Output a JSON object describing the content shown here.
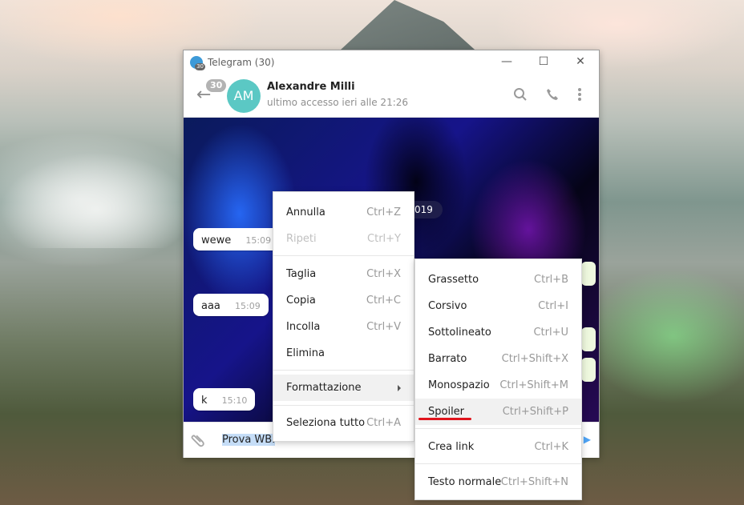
{
  "window": {
    "title": "Telegram (30)",
    "app_icon_badge": "30",
    "controls": {
      "minimize": "—",
      "maximize": "☐",
      "close": "✕"
    }
  },
  "chat_header": {
    "unread_count": "30",
    "avatar_initials": "AM",
    "contact_name": "Alexandre Milli",
    "status": "ultimo accesso ieri alle 21:26"
  },
  "chat": {
    "date_pill": "019",
    "messages": [
      {
        "text": "wewe",
        "time": "15:09"
      },
      {
        "text": "aaa",
        "time": "15:09"
      },
      {
        "text": "k",
        "time": "15:10"
      }
    ]
  },
  "composer": {
    "text": "Prova WBI"
  },
  "context_menu": {
    "items": [
      {
        "label": "Annulla",
        "shortcut": "Ctrl+Z"
      },
      {
        "label": "Ripeti",
        "shortcut": "Ctrl+Y"
      },
      {
        "label": "Taglia",
        "shortcut": "Ctrl+X"
      },
      {
        "label": "Copia",
        "shortcut": "Ctrl+C"
      },
      {
        "label": "Incolla",
        "shortcut": "Ctrl+V"
      },
      {
        "label": "Elimina",
        "shortcut": ""
      },
      {
        "label": "Formattazione",
        "shortcut": ""
      },
      {
        "label": "Seleziona tutto",
        "shortcut": "Ctrl+A"
      }
    ]
  },
  "format_submenu": {
    "items": [
      {
        "label": "Grassetto",
        "shortcut": "Ctrl+B"
      },
      {
        "label": "Corsivo",
        "shortcut": "Ctrl+I"
      },
      {
        "label": "Sottolineato",
        "shortcut": "Ctrl+U"
      },
      {
        "label": "Barrato",
        "shortcut": "Ctrl+Shift+X"
      },
      {
        "label": "Monospazio",
        "shortcut": "Ctrl+Shift+M"
      },
      {
        "label": "Spoiler",
        "shortcut": "Ctrl+Shift+P"
      },
      {
        "label": "Crea link",
        "shortcut": "Ctrl+K"
      },
      {
        "label": "Testo normale",
        "shortcut": "Ctrl+Shift+N"
      }
    ]
  },
  "colors": {
    "avatar": "#5bc8c4",
    "accent": "#4ea4f6",
    "highlight_underline": "#e0141c"
  }
}
